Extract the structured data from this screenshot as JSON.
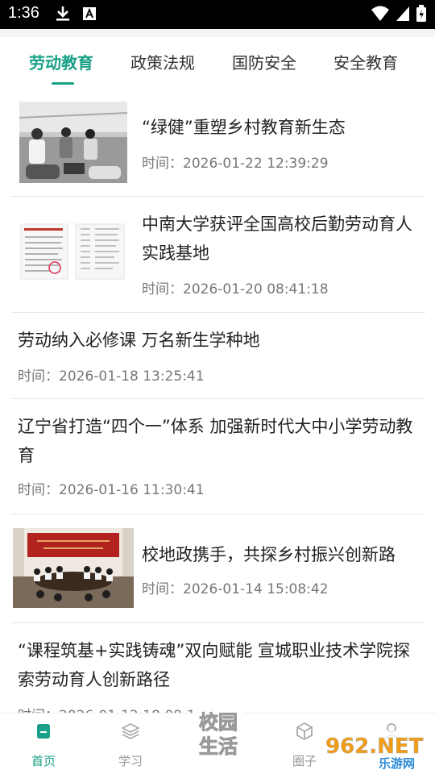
{
  "status_bar": {
    "time": "1:36",
    "icons": [
      "download-icon",
      "a-icon",
      "wifi-icon",
      "cell-signal-icon",
      "battery-icon"
    ]
  },
  "tabs": [
    {
      "label": "劳动教育",
      "active": true
    },
    {
      "label": "政策法规",
      "active": false
    },
    {
      "label": "国防安全",
      "active": false
    },
    {
      "label": "安全教育",
      "active": false
    }
  ],
  "articles": [
    {
      "title": "“绿健”重塑乡村教育新生态",
      "time": "时间：2026-01-22 12:39:29",
      "image": "children-planting-photo"
    },
    {
      "title": "中南大学获评全国高校后勤劳动育人实践基地",
      "time": "时间：2026-01-20 08:41:18",
      "image": "document-scan-photo"
    },
    {
      "title": "劳动纳入必修课 万名新生学种地",
      "time": "时间：2026-01-18 13:25:41"
    },
    {
      "title": "辽宁省打造“四个一”体系 加强新时代大中小学劳动教育",
      "time": "时间：2026-01-16 11:30:41"
    },
    {
      "title": "校地政携手，共探乡村振兴创新路",
      "time": "时间：2026-01-14 15:08:42",
      "image": "meeting-room-photo"
    },
    {
      "title": "“课程筑基+实践铸魂”双向赋能 宣城职业技术学院探索劳动育人创新路径",
      "time": "时间：2026-01-12 18:09:1"
    }
  ],
  "bottom_nav": [
    {
      "label": "首页",
      "icon": "home-icon",
      "active": true
    },
    {
      "label": "学习",
      "icon": "layers-icon",
      "active": false
    },
    {
      "label": "",
      "icon": "campus-life-logo",
      "active": false
    },
    {
      "label": "圈子",
      "icon": "cube-icon",
      "active": false
    },
    {
      "label": "",
      "icon": "profile-icon",
      "active": false
    }
  ],
  "center_logo_text": [
    "校园",
    "生活"
  ],
  "watermark": {
    "brand": "962.NET",
    "sub": "乐游网"
  },
  "colors": {
    "accent": "#1aa087",
    "text": "#222222",
    "muted": "#777777",
    "divider": "#e6e6e6"
  }
}
